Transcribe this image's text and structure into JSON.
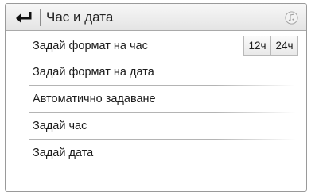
{
  "header": {
    "title": "Час и дата",
    "back_icon": "back-arrow-icon",
    "audio_icon": "music-note-icon"
  },
  "menu": {
    "items": [
      {
        "label": "Задай формат на час"
      },
      {
        "label": "Задай формат на дата"
      },
      {
        "label": "Автоматично задаване"
      },
      {
        "label": "Задай час"
      },
      {
        "label": "Задай дата"
      }
    ],
    "time_format_options": [
      "12ч",
      "24ч"
    ]
  }
}
